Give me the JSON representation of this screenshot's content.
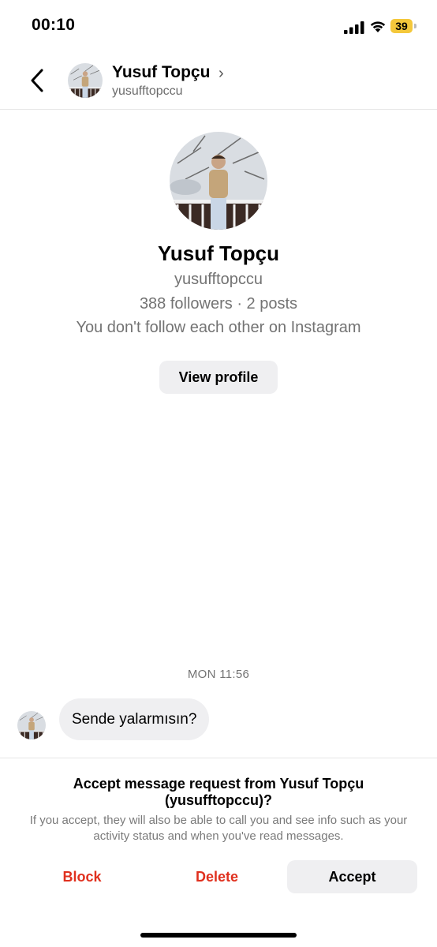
{
  "status_bar": {
    "time": "00:10",
    "battery": "39"
  },
  "header": {
    "name": "Yusuf Topçu",
    "username": "yusufftopccu",
    "chevron": "›"
  },
  "profile": {
    "name": "Yusuf Topçu",
    "username": "yusufftopccu",
    "stats": "388 followers · 2 posts",
    "relation": "You don't follow each other on Instagram",
    "view_profile_label": "View profile"
  },
  "chat": {
    "timestamp": "MON 11:56",
    "messages": [
      {
        "text": "Sende yalarmısın?"
      }
    ]
  },
  "request": {
    "title_line1": "Accept message request from Yusuf Topçu",
    "title_line2": "(yusufftopccu)?",
    "description": "If you accept, they will also be able to call you and see info such as your activity status and when you've read messages.",
    "block_label": "Block",
    "delete_label": "Delete",
    "accept_label": "Accept"
  },
  "icons": {
    "back": "chevron-left-icon",
    "signal": "cellular-signal-icon",
    "wifi": "wifi-icon",
    "battery": "battery-icon"
  },
  "colors": {
    "destructive": "#e0301e",
    "secondary_text": "#737373",
    "button_bg": "#efeff1",
    "battery": "#f4c83b"
  }
}
